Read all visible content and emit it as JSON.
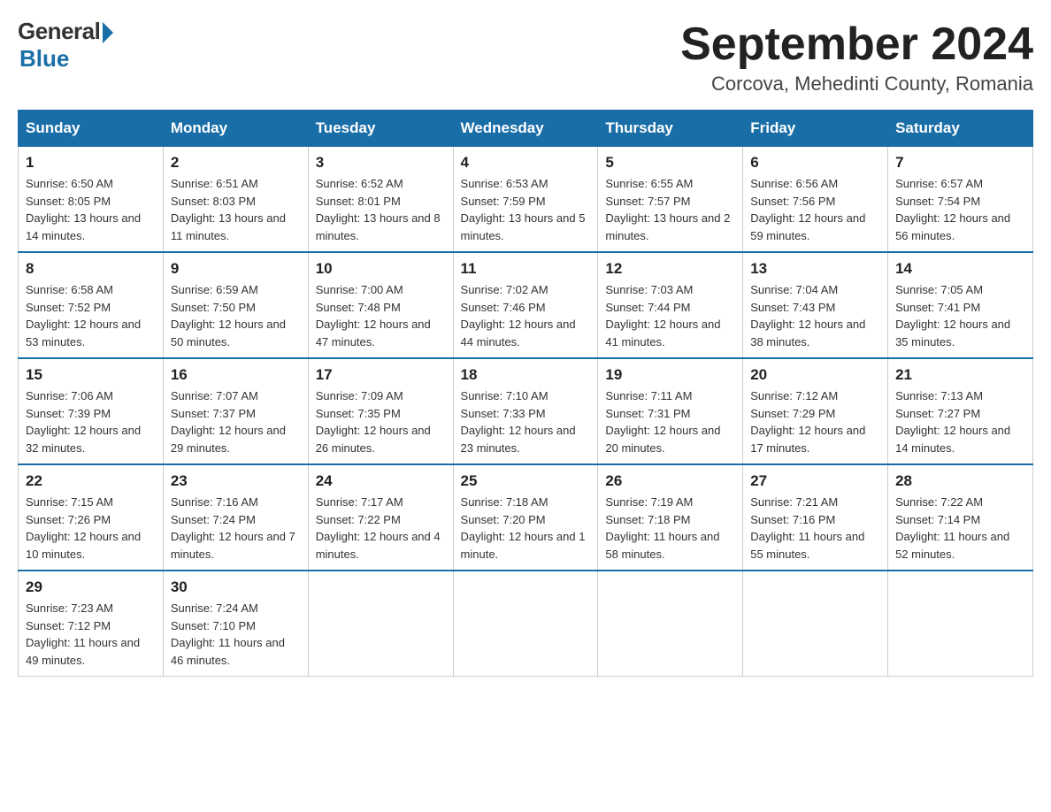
{
  "logo": {
    "general": "General",
    "blue": "Blue"
  },
  "title": "September 2024",
  "location": "Corcova, Mehedinti County, Romania",
  "headers": [
    "Sunday",
    "Monday",
    "Tuesday",
    "Wednesday",
    "Thursday",
    "Friday",
    "Saturday"
  ],
  "weeks": [
    [
      {
        "day": "1",
        "sunrise": "6:50 AM",
        "sunset": "8:05 PM",
        "daylight": "13 hours and 14 minutes."
      },
      {
        "day": "2",
        "sunrise": "6:51 AM",
        "sunset": "8:03 PM",
        "daylight": "13 hours and 11 minutes."
      },
      {
        "day": "3",
        "sunrise": "6:52 AM",
        "sunset": "8:01 PM",
        "daylight": "13 hours and 8 minutes."
      },
      {
        "day": "4",
        "sunrise": "6:53 AM",
        "sunset": "7:59 PM",
        "daylight": "13 hours and 5 minutes."
      },
      {
        "day": "5",
        "sunrise": "6:55 AM",
        "sunset": "7:57 PM",
        "daylight": "13 hours and 2 minutes."
      },
      {
        "day": "6",
        "sunrise": "6:56 AM",
        "sunset": "7:56 PM",
        "daylight": "12 hours and 59 minutes."
      },
      {
        "day": "7",
        "sunrise": "6:57 AM",
        "sunset": "7:54 PM",
        "daylight": "12 hours and 56 minutes."
      }
    ],
    [
      {
        "day": "8",
        "sunrise": "6:58 AM",
        "sunset": "7:52 PM",
        "daylight": "12 hours and 53 minutes."
      },
      {
        "day": "9",
        "sunrise": "6:59 AM",
        "sunset": "7:50 PM",
        "daylight": "12 hours and 50 minutes."
      },
      {
        "day": "10",
        "sunrise": "7:00 AM",
        "sunset": "7:48 PM",
        "daylight": "12 hours and 47 minutes."
      },
      {
        "day": "11",
        "sunrise": "7:02 AM",
        "sunset": "7:46 PM",
        "daylight": "12 hours and 44 minutes."
      },
      {
        "day": "12",
        "sunrise": "7:03 AM",
        "sunset": "7:44 PM",
        "daylight": "12 hours and 41 minutes."
      },
      {
        "day": "13",
        "sunrise": "7:04 AM",
        "sunset": "7:43 PM",
        "daylight": "12 hours and 38 minutes."
      },
      {
        "day": "14",
        "sunrise": "7:05 AM",
        "sunset": "7:41 PM",
        "daylight": "12 hours and 35 minutes."
      }
    ],
    [
      {
        "day": "15",
        "sunrise": "7:06 AM",
        "sunset": "7:39 PM",
        "daylight": "12 hours and 32 minutes."
      },
      {
        "day": "16",
        "sunrise": "7:07 AM",
        "sunset": "7:37 PM",
        "daylight": "12 hours and 29 minutes."
      },
      {
        "day": "17",
        "sunrise": "7:09 AM",
        "sunset": "7:35 PM",
        "daylight": "12 hours and 26 minutes."
      },
      {
        "day": "18",
        "sunrise": "7:10 AM",
        "sunset": "7:33 PM",
        "daylight": "12 hours and 23 minutes."
      },
      {
        "day": "19",
        "sunrise": "7:11 AM",
        "sunset": "7:31 PM",
        "daylight": "12 hours and 20 minutes."
      },
      {
        "day": "20",
        "sunrise": "7:12 AM",
        "sunset": "7:29 PM",
        "daylight": "12 hours and 17 minutes."
      },
      {
        "day": "21",
        "sunrise": "7:13 AM",
        "sunset": "7:27 PM",
        "daylight": "12 hours and 14 minutes."
      }
    ],
    [
      {
        "day": "22",
        "sunrise": "7:15 AM",
        "sunset": "7:26 PM",
        "daylight": "12 hours and 10 minutes."
      },
      {
        "day": "23",
        "sunrise": "7:16 AM",
        "sunset": "7:24 PM",
        "daylight": "12 hours and 7 minutes."
      },
      {
        "day": "24",
        "sunrise": "7:17 AM",
        "sunset": "7:22 PM",
        "daylight": "12 hours and 4 minutes."
      },
      {
        "day": "25",
        "sunrise": "7:18 AM",
        "sunset": "7:20 PM",
        "daylight": "12 hours and 1 minute."
      },
      {
        "day": "26",
        "sunrise": "7:19 AM",
        "sunset": "7:18 PM",
        "daylight": "11 hours and 58 minutes."
      },
      {
        "day": "27",
        "sunrise": "7:21 AM",
        "sunset": "7:16 PM",
        "daylight": "11 hours and 55 minutes."
      },
      {
        "day": "28",
        "sunrise": "7:22 AM",
        "sunset": "7:14 PM",
        "daylight": "11 hours and 52 minutes."
      }
    ],
    [
      {
        "day": "29",
        "sunrise": "7:23 AM",
        "sunset": "7:12 PM",
        "daylight": "11 hours and 49 minutes."
      },
      {
        "day": "30",
        "sunrise": "7:24 AM",
        "sunset": "7:10 PM",
        "daylight": "11 hours and 46 minutes."
      },
      null,
      null,
      null,
      null,
      null
    ]
  ]
}
